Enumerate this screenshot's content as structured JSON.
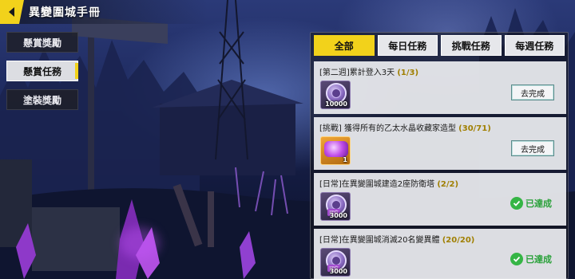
{
  "header": {
    "title": "異變圍城手冊",
    "back_icon": "back-arrow-icon",
    "accent_color": "#f2d21b"
  },
  "side_tabs": [
    {
      "label": "懸賞獎勵",
      "active": false
    },
    {
      "label": "懸賞任務",
      "active": true
    },
    {
      "label": "塗裝獎勵",
      "active": false
    }
  ],
  "filter_tabs": [
    {
      "label": "全部",
      "active": true
    },
    {
      "label": "每日任務",
      "active": false
    },
    {
      "label": "挑戰任務",
      "active": false
    },
    {
      "label": "每週任務",
      "active": false
    }
  ],
  "tasks": [
    {
      "title": "[第二週]累計登入3天",
      "progress": "(1/3)",
      "reward_icon": "purple-coin-icon",
      "reward_qty": "10000",
      "status": "go",
      "button_label": "去完成"
    },
    {
      "title": "[挑戰] 獲得所有的乙太水晶收藏家造型",
      "progress": "(30/71)",
      "reward_icon": "ether-crystal-skin-icon",
      "reward_qty": "1",
      "status": "go",
      "button_label": "去完成"
    },
    {
      "title": "[日常]在異變圍城建造2座防衛塔",
      "progress": "(2/2)",
      "reward_icon": "purple-coin-icon",
      "reward_qty": "3000",
      "reward_tag": "冠位",
      "status": "done",
      "done_label": "已達成"
    },
    {
      "title": "[日常]在異變圍城消滅20名變異體",
      "progress": "(20/20)",
      "reward_icon": "purple-coin-icon",
      "reward_qty": "3000",
      "reward_tag": "冠位",
      "status": "done",
      "done_label": "已達成"
    }
  ]
}
